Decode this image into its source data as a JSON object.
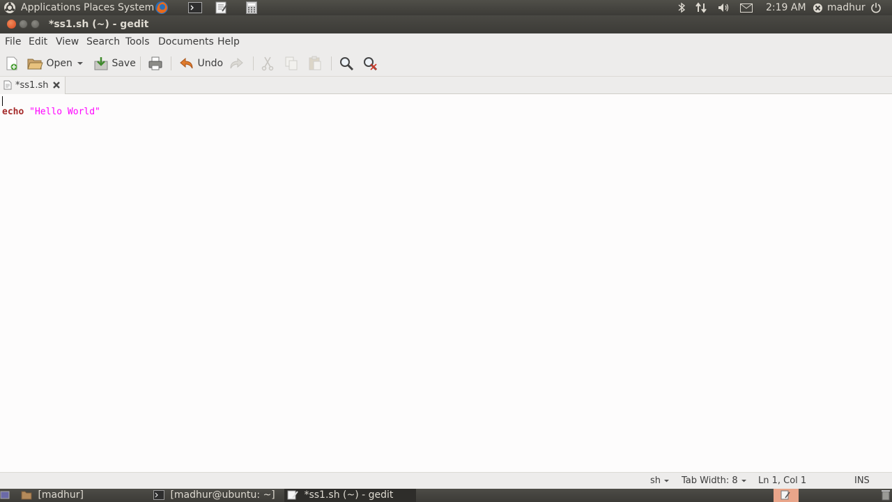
{
  "top_panel": {
    "menus": [
      "Applications",
      "Places",
      "System"
    ],
    "clock": "2:19 AM",
    "user": "madhur"
  },
  "window": {
    "title": "*ss1.sh (~) - gedit"
  },
  "menubar": {
    "items": [
      "File",
      "Edit",
      "View",
      "Search",
      "Tools",
      "Documents",
      "Help"
    ]
  },
  "toolbar": {
    "open_label": "Open",
    "save_label": "Save",
    "undo_label": "Undo"
  },
  "tab": {
    "label": "*ss1.sh"
  },
  "editor": {
    "keyword": "echo",
    "string": "\"Hello World\""
  },
  "statusbar": {
    "language": "sh",
    "tab_width": "Tab Width: 8",
    "position": "Ln 1, Col 1",
    "mode": "INS"
  },
  "taskbar": {
    "items": [
      "[madhur]",
      "[madhur@ubuntu: ~]",
      "*ss1.sh (~) - gedit"
    ]
  },
  "colors": {
    "keyword": "#a52a2a",
    "string": "#ff00ff",
    "close_button": "#e0653a"
  }
}
